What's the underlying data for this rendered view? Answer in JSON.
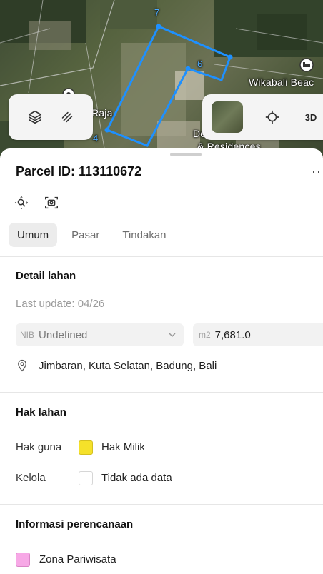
{
  "map": {
    "place_label_1": "Raja",
    "place_label_2": "Wikabali Beac",
    "place_label_3": "De",
    "place_label_4": "& Residences",
    "vertex_label_a": "6",
    "vertex_label_b": "4",
    "vertex_label_c": "7",
    "parcel_outline_color": "#1e90ff",
    "view_mode_label": "3D"
  },
  "parcel": {
    "title": "Parcel ID: 113110672",
    "more_label": "···"
  },
  "tabs": [
    {
      "label": "Umum",
      "active": true
    },
    {
      "label": "Pasar",
      "active": false
    },
    {
      "label": "Tindakan",
      "active": false
    }
  ],
  "detail": {
    "section_title": "Detail lahan",
    "last_update": "Last update: 04/26",
    "nib_prefix": "NIB",
    "nib_value": "Undefined",
    "area_prefix": "m2",
    "area_value": "7,681.0",
    "location": "Jimbaran, Kuta Selatan, Badung, Bali"
  },
  "rights": {
    "section_title": "Hak lahan",
    "hak_guna_label": "Hak guna",
    "hak_guna_value": "Hak Milik",
    "hak_guna_color": "#f5e12a",
    "kelola_label": "Kelola",
    "kelola_value": "Tidak ada data",
    "kelola_color": "#ffffff"
  },
  "planning": {
    "section_title": "Informasi perencanaan",
    "zone_value": "Zona Pariwisata",
    "zone_color": "#f7a8e6"
  }
}
